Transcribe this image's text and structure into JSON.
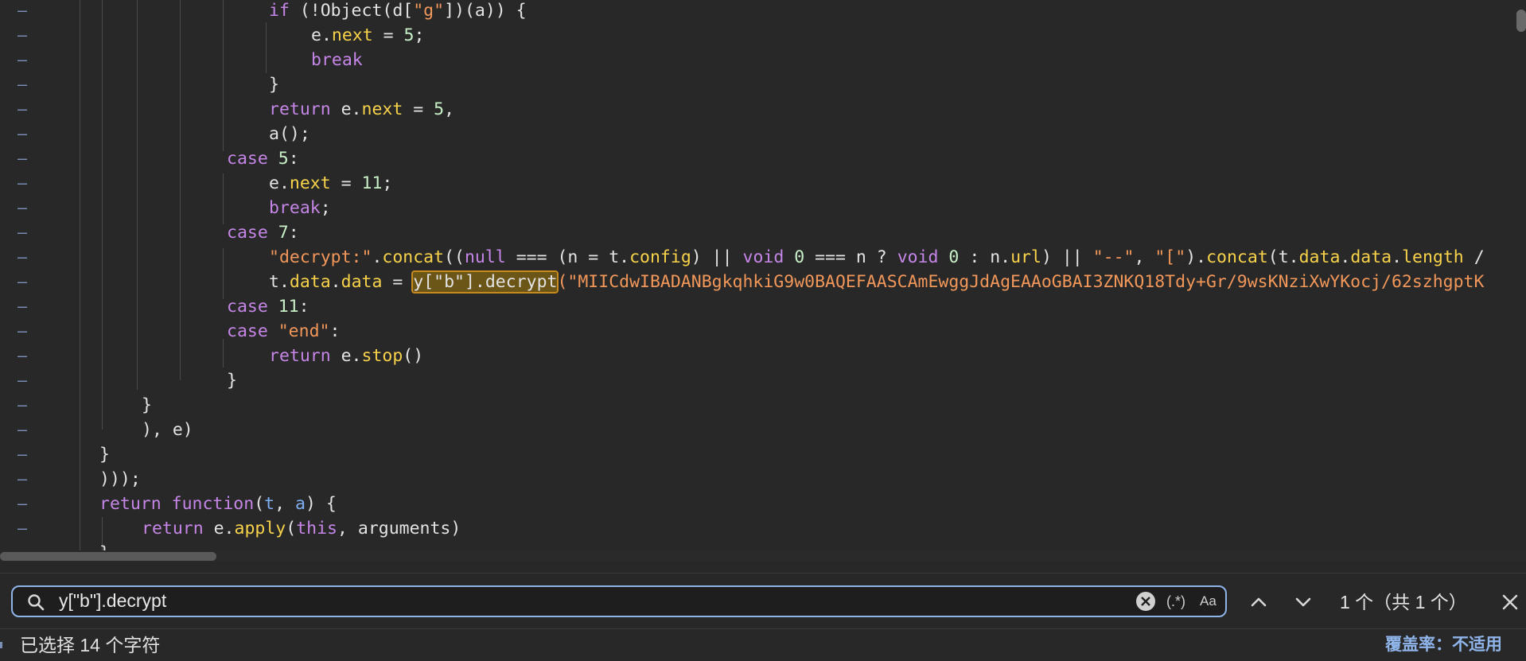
{
  "editor": {
    "gutter_marker": "–",
    "lines": {
      "l1": {
        "a": "if",
        "b": " (!Object(d[",
        "c": "\"g\"",
        "d": "])(a)) {"
      },
      "l2": {
        "a": "e.",
        "b": "next",
        "c": " = ",
        "d": "5",
        "e": ";"
      },
      "l3": {
        "a": "break"
      },
      "l4": {
        "a": "}"
      },
      "l5": {
        "a": "return",
        "b": " e.",
        "c": "next",
        "d": " = ",
        "e": "5",
        "f": ","
      },
      "l6": {
        "a": "a();"
      },
      "l7": {
        "a": "case",
        "b": " ",
        "c": "5",
        "d": ":"
      },
      "l8": {
        "a": "e.",
        "b": "next",
        "c": " = ",
        "d": "11",
        "e": ";"
      },
      "l9": {
        "a": "break",
        "b": ";"
      },
      "l10": {
        "a": "case",
        "b": " ",
        "c": "7",
        "d": ":"
      },
      "l11": {
        "a": "\"decrypt:\"",
        "b": ".",
        "c": "concat",
        "d": "((",
        "e": "null",
        "f": " === (n = t.",
        "g": "config",
        "h": ") || ",
        "i": "void",
        "j": " ",
        "k": "0",
        "l": " === n ? ",
        "m": "void",
        "n": " ",
        "o": "0",
        "p": " : n.",
        "q": "url",
        "r": ") || ",
        "s": "\"--\"",
        "t": ", ",
        "u": "\"[\"",
        "v": ").",
        "w": "concat",
        "x": "(t.",
        "y": "data",
        "z": ".",
        "aa": "data",
        "ab": ".",
        "ac": "length",
        "ad": " /"
      },
      "l12": {
        "a": "t.",
        "b": "data",
        "c": ".",
        "d": "data",
        "e": " = ",
        "f": "y[\"b\"].decrypt",
        "g": "(",
        "h": "\"MIICdwIBADANBgkqhkiG9w0BAQEFAASCAmEwggJdAgEAAoGBAI3ZNKQ18Tdy+Gr/9wsKNziXwYKocj/62szhgptK"
      },
      "l13": {
        "a": "case",
        "b": " ",
        "c": "11",
        "d": ":"
      },
      "l14": {
        "a": "case",
        "b": " ",
        "c": "\"end\"",
        "d": ":"
      },
      "l15": {
        "a": "return",
        "b": " e.",
        "c": "stop",
        "d": "()"
      },
      "l16": {
        "a": "}"
      },
      "l17": {
        "a": "}"
      },
      "l18": {
        "a": "), e)"
      },
      "l19": {
        "a": "}"
      },
      "l20": {
        "a": ")));"
      },
      "l21": {
        "a": "return",
        "b": " ",
        "c": "function",
        "d": "(",
        "e": "t",
        "f": ", ",
        "g": "a",
        "h": ") {"
      },
      "l22": {
        "a": "return",
        "b": " e.",
        "c": "apply",
        "d": "(",
        "e": "this",
        "f": ", arguments)"
      },
      "l23": {
        "a": "}"
      }
    }
  },
  "search": {
    "query": "y[\"b\"].decrypt",
    "regex_label": "(.*)",
    "case_label": "Aa",
    "match_count": "1 个（共 1 个）",
    "icons": [
      "search-icon",
      "clear-icon",
      "chevron-up-icon",
      "chevron-down-icon",
      "close-icon"
    ]
  },
  "status": {
    "selection": "已选择 14 个字符",
    "coverage": "覆盖率：不适用"
  },
  "colors": {
    "background": "#282828",
    "keyword": "#c586e8",
    "property": "#f7d24a",
    "number": "#c7f0c7",
    "string": "#f2975a",
    "highlight": "#6b5617",
    "accent": "#8fb4ea"
  }
}
